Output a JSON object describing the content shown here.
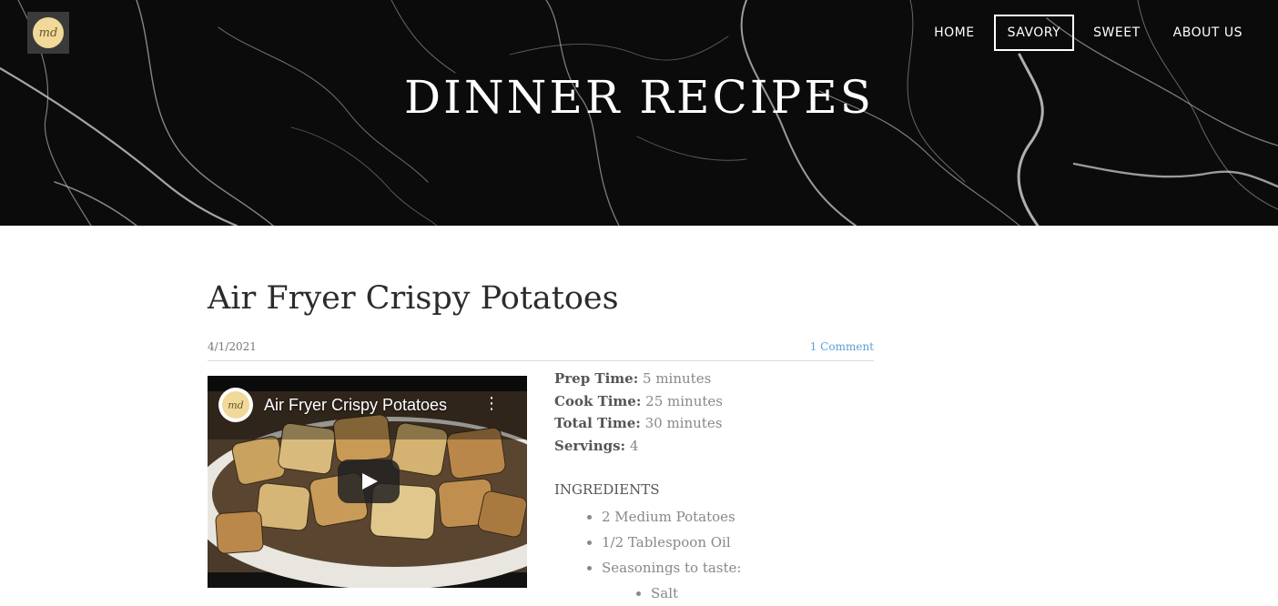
{
  "header": {
    "logo_text": "md",
    "nav": [
      {
        "label": "HOME",
        "active": false
      },
      {
        "label": "SAVORY",
        "active": true
      },
      {
        "label": "SWEET",
        "active": false
      },
      {
        "label": "ABOUT US",
        "active": false
      }
    ],
    "title": "DINNER RECIPES"
  },
  "post": {
    "title": "Air Fryer Crispy Potatoes",
    "date": "4/1/2021",
    "comments": "1 Comment",
    "video": {
      "title": "Air Fryer Crispy Potatoes",
      "channel_icon": "channel-logo",
      "menu_icon": "more-vert-icon",
      "play_icon": "play-icon"
    },
    "details": {
      "prep_label": "Prep Time:",
      "prep_value": " 5 minutes",
      "cook_label": "Cook Time:",
      "cook_value": " 25 minutes",
      "total_label": "Total Time:",
      "total_value": " 30 minutes",
      "servings_label": "Servings:",
      "servings_value": " 4"
    },
    "ingredients_heading": "INGREDIENTS",
    "ingredients": [
      "2 Medium Potatoes",
      "1/2 Tablespoon Oil",
      "Seasonings to taste:"
    ],
    "seasonings": [
      "Salt"
    ]
  },
  "colors": {
    "hero_bg": "#0b0b0b",
    "link": "#5c9fd6",
    "logo_gold": "#f1d99a"
  }
}
